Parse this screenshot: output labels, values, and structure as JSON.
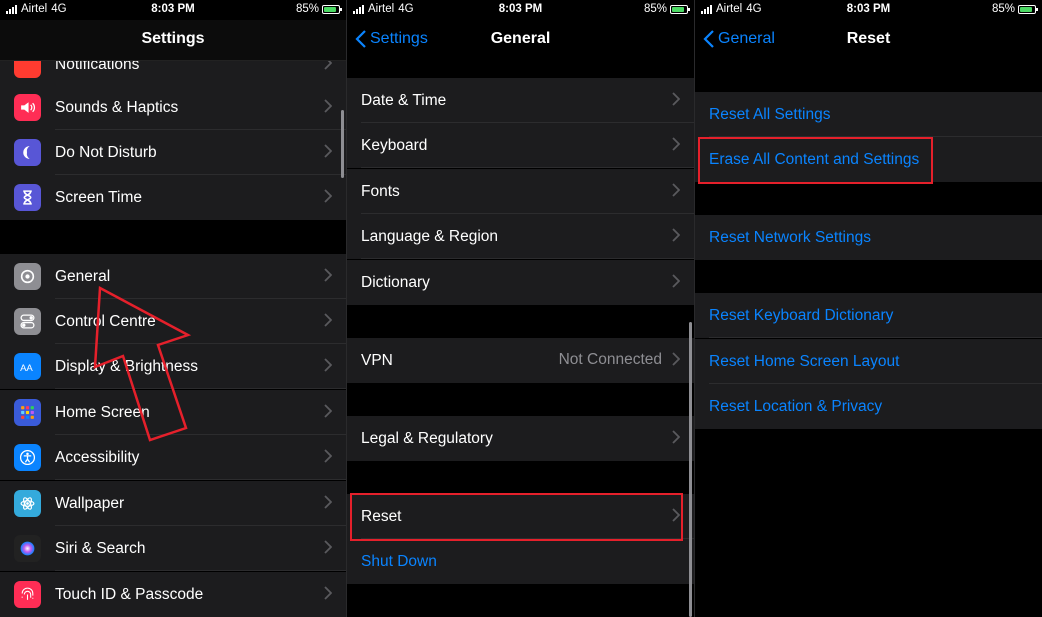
{
  "status": {
    "carrier": "Airtel",
    "network": "4G",
    "time": "8:03 PM",
    "battery": "85%"
  },
  "settings": {
    "title": "Settings",
    "items": [
      {
        "label": "Notifications",
        "icon": "notifications-icon",
        "color": "#ff3b30"
      },
      {
        "label": "Sounds & Haptics",
        "icon": "speaker-icon",
        "color": "#ff2d55"
      },
      {
        "label": "Do Not Disturb",
        "icon": "moon-icon",
        "color": "#5856d6"
      },
      {
        "label": "Screen Time",
        "icon": "hourglass-icon",
        "color": "#5856d6"
      },
      {
        "label": "General",
        "icon": "gear-icon",
        "color": "#8e8e93"
      },
      {
        "label": "Control Centre",
        "icon": "toggles-icon",
        "color": "#8e8e93"
      },
      {
        "label": "Display & Brightness",
        "icon": "text-size-icon",
        "color": "#0a84ff"
      },
      {
        "label": "Home Screen",
        "icon": "grid-icon",
        "color": "#3a5bd9"
      },
      {
        "label": "Accessibility",
        "icon": "accessibility-icon",
        "color": "#0a84ff"
      },
      {
        "label": "Wallpaper",
        "icon": "flower-icon",
        "color": "#34aadc"
      },
      {
        "label": "Siri & Search",
        "icon": "siri-icon",
        "color": "#222222"
      },
      {
        "label": "Touch ID & Passcode",
        "icon": "fingerprint-icon",
        "color": "#ff2d55"
      }
    ]
  },
  "general": {
    "back": "Settings",
    "title": "General",
    "items": [
      {
        "label": "Date & Time"
      },
      {
        "label": "Keyboard"
      },
      {
        "label": "Fonts"
      },
      {
        "label": "Language & Region"
      },
      {
        "label": "Dictionary"
      },
      {
        "label": "VPN",
        "value": "Not Connected"
      },
      {
        "label": "Legal & Regulatory"
      },
      {
        "label": "Reset"
      },
      {
        "label": "Shut Down"
      }
    ]
  },
  "reset": {
    "back": "General",
    "title": "Reset",
    "items": [
      {
        "label": "Reset All Settings"
      },
      {
        "label": "Erase All Content and Settings"
      },
      {
        "label": "Reset Network Settings"
      },
      {
        "label": "Reset Keyboard Dictionary"
      },
      {
        "label": "Reset Home Screen Layout"
      },
      {
        "label": "Reset Location & Privacy"
      }
    ]
  },
  "colors": {
    "accent": "#0a84ff",
    "highlight": "#e5202b",
    "row_bg": "#1c1c1e"
  }
}
